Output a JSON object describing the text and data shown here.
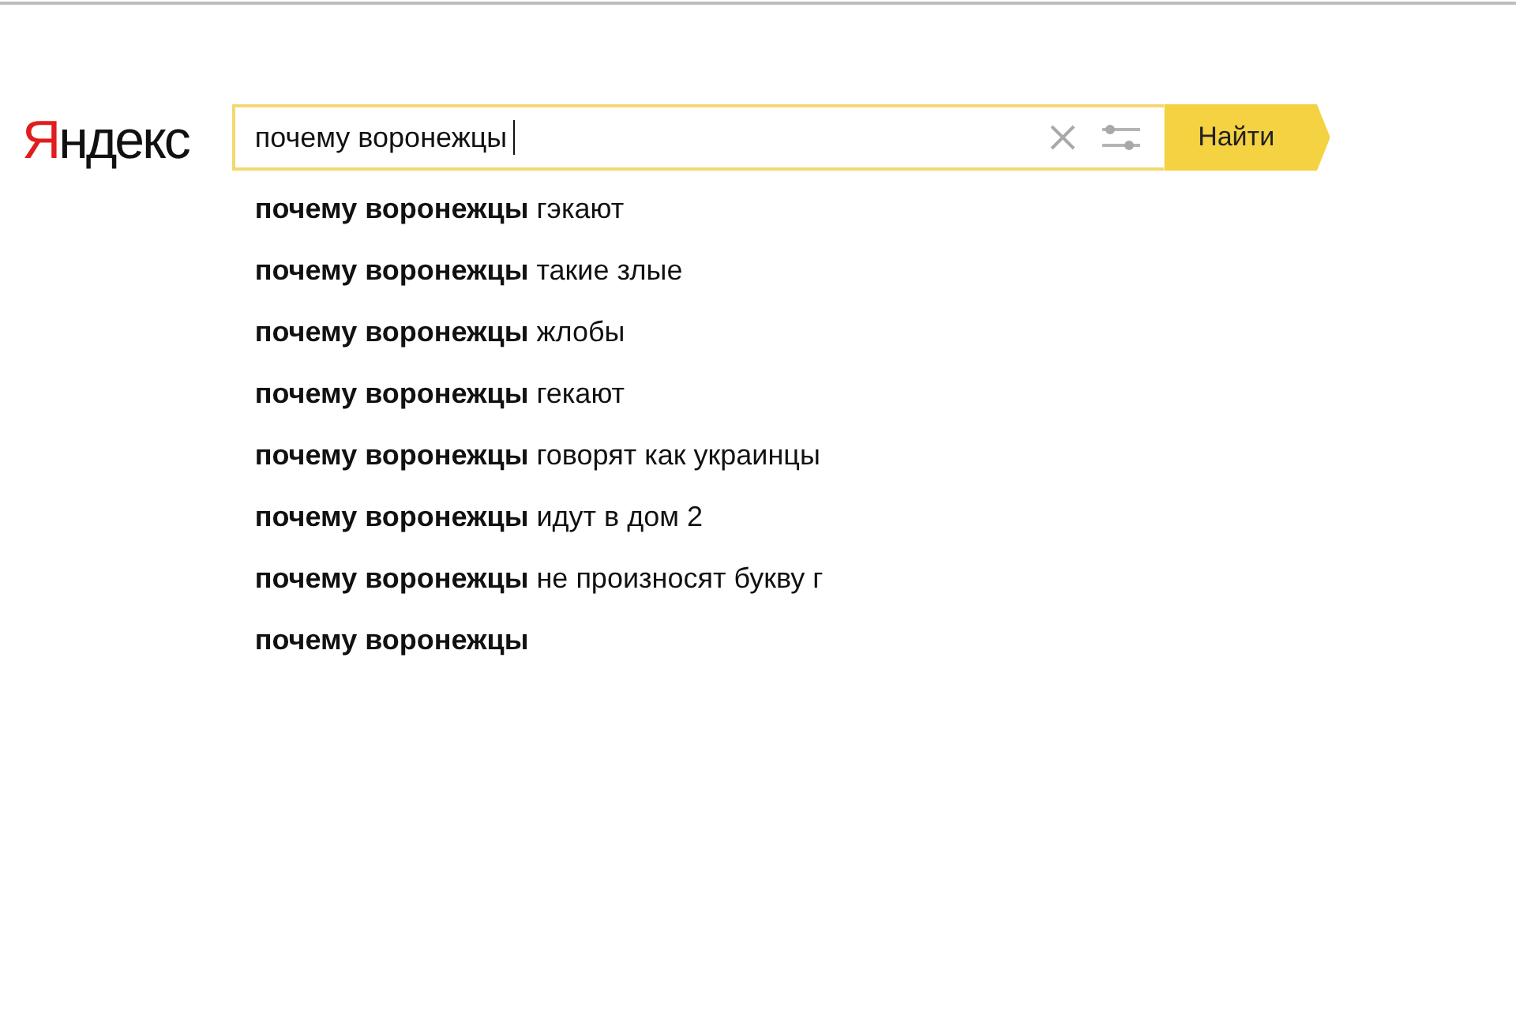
{
  "logo": "Яндекс",
  "search": {
    "value": "почему воронежцы",
    "button": "Найти"
  },
  "suggestions": [
    "**почему воронежцы** гэкают",
    "**почему воронежцы** такие злые",
    "**почему воронежцы** жлобы",
    "**почему воронежцы** гекают",
    "**почему воронежцы** говорят как украинцы",
    "**почему воронежцы** идут в дом 2",
    "**почему воронежцы** не произносят букву г",
    "**почему воронежцы**"
  ]
}
